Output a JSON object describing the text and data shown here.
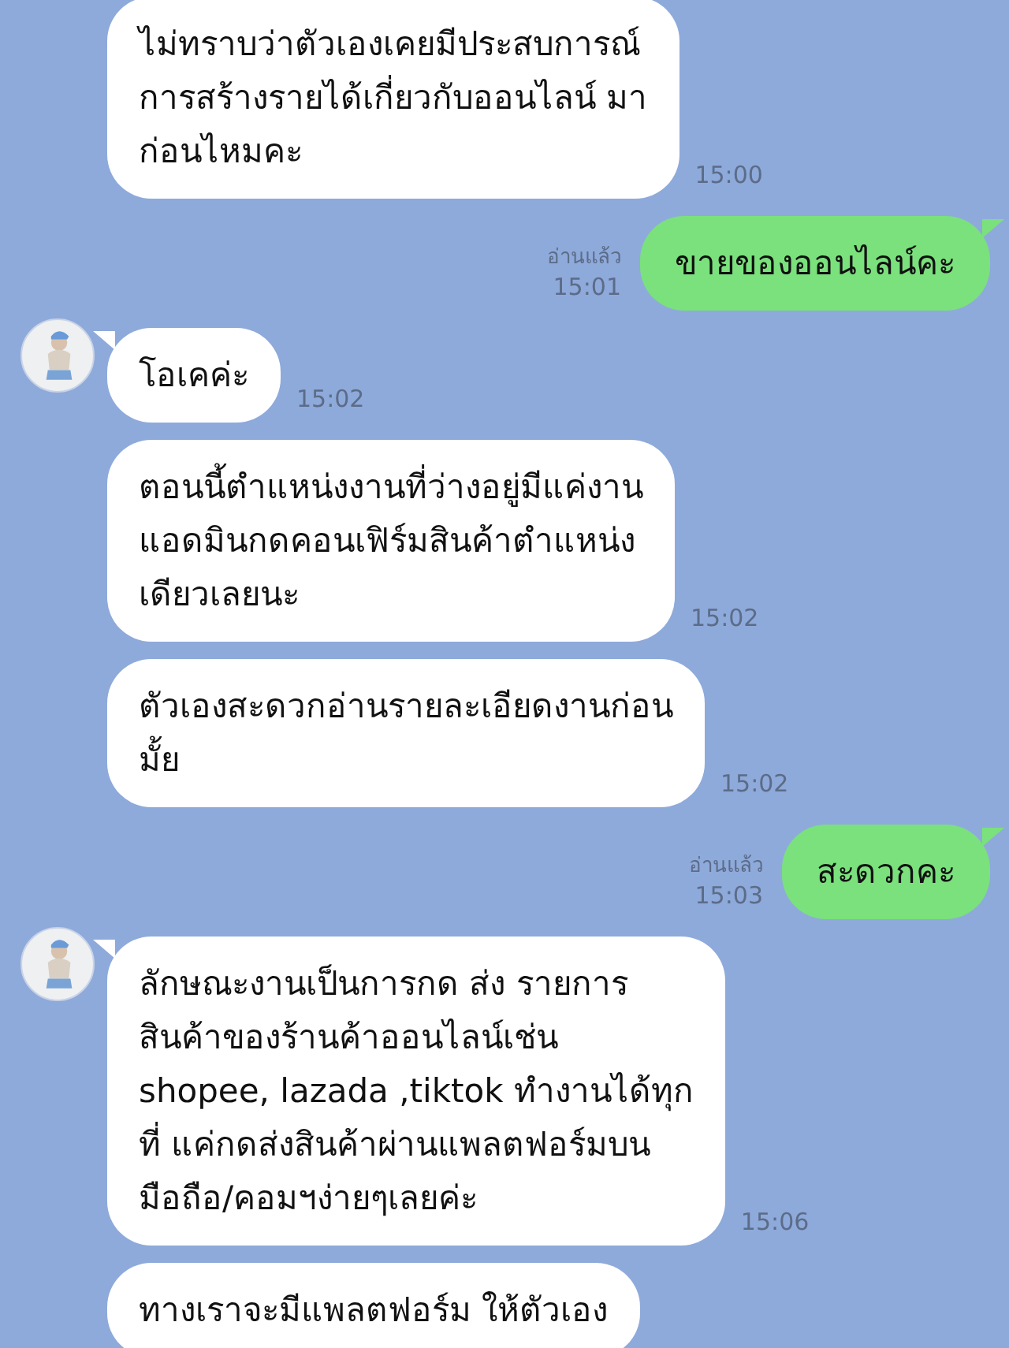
{
  "messages": [
    {
      "kind": "received",
      "show_avatar": false,
      "text": "ไม่ทราบว่าตัวเองเคยมีประสบการณ์\nการสร้างรายได้เกี่ยวกับออนไลน์ มา\nก่อนไหมคะ",
      "time": "15:00"
    },
    {
      "kind": "sent",
      "text": "ขายของออนไลน์คะ",
      "read": "อ่านแล้ว",
      "time": "15:01"
    },
    {
      "kind": "received",
      "show_avatar": true,
      "text": "โอเคค่ะ",
      "time": "15:02"
    },
    {
      "kind": "received",
      "show_avatar": false,
      "text": "ตอนนี้ตำแหน่งงานที่ว่างอยู่มีแค่งาน\nแอดมินกดคอนเฟิร์มสินค้าตำแหน่ง\nเดียวเลยนะ",
      "time": "15:02"
    },
    {
      "kind": "received",
      "show_avatar": false,
      "text": "ตัวเองสะดวกอ่านรายละเอียดงานก่อน\nมั้ย",
      "time": "15:02"
    },
    {
      "kind": "sent",
      "text": "สะดวกคะ",
      "read": "อ่านแล้ว",
      "time": "15:03"
    },
    {
      "kind": "received",
      "show_avatar": true,
      "text": "ลักษณะงานเป็นการกด ส่ง รายการ\nสินค้าของร้านค้าออนไลน์เช่น\nshopee, lazada ,tiktok ทำงานได้ทุก\nที่ แค่กดส่งสินค้าผ่านแพลตฟอร์มบน\nมือถือ/คอมฯง่ายๆเลยค่ะ",
      "time": "15:06"
    },
    {
      "kind": "received",
      "show_avatar": false,
      "text": "ทางเราจะมีแพลตฟอร์ม ให้ตัวเอง"
    }
  ]
}
